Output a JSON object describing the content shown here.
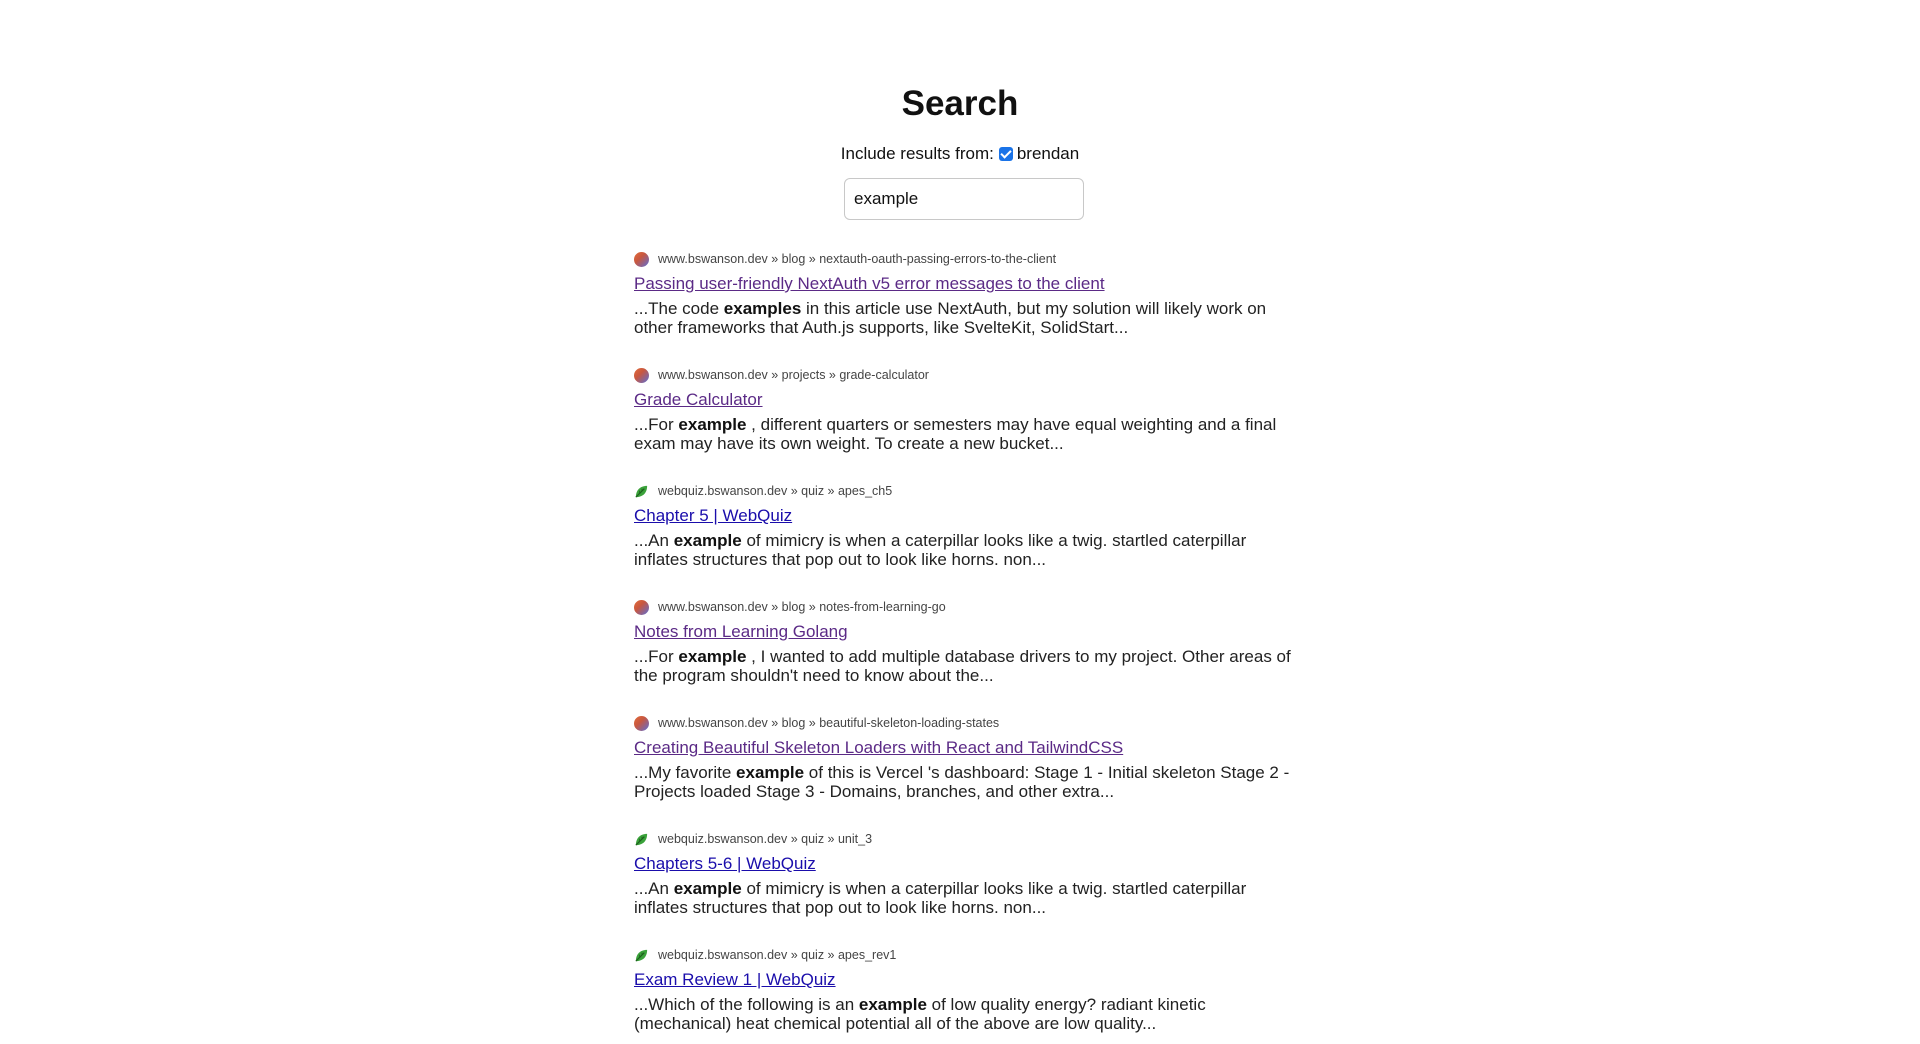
{
  "page": {
    "title": "Search"
  },
  "filter": {
    "label": "Include results from:",
    "option_label": "brendan",
    "option_checked": true
  },
  "search": {
    "value": "example",
    "placeholder": ""
  },
  "results": [
    {
      "icon": "site-orb-icon",
      "breadcrumb": "www.bswanson.dev » blog » nextauth-oauth-passing-errors-to-the-client",
      "title": "Passing user-friendly NextAuth v5 error messages to the client",
      "visited": true,
      "snippet_before": "...The code ",
      "snippet_match": "examples",
      "snippet_after": " in this article use NextAuth, but my solution will likely work on other frameworks that Auth.js supports, like SvelteKit, SolidStart..."
    },
    {
      "icon": "site-orb-icon",
      "breadcrumb": "www.bswanson.dev » projects » grade-calculator",
      "title": "Grade Calculator",
      "visited": true,
      "snippet_before": "...For ",
      "snippet_match": "example",
      "snippet_after": " , different quarters or semesters may have equal weighting and a final exam may have its own weight. To create a new bucket..."
    },
    {
      "icon": "leaf-icon",
      "breadcrumb": "webquiz.bswanson.dev » quiz » apes_ch5",
      "title": "Chapter 5 | WebQuiz",
      "visited": false,
      "snippet_before": "...An ",
      "snippet_match": "example",
      "snippet_after": " of mimicry is when a caterpillar looks like a twig. startled caterpillar inflates structures that pop out to look like horns. non..."
    },
    {
      "icon": "site-orb-icon",
      "breadcrumb": "www.bswanson.dev » blog » notes-from-learning-go",
      "title": "Notes from Learning Golang",
      "visited": true,
      "snippet_before": "...For ",
      "snippet_match": "example",
      "snippet_after": " , I wanted to add multiple database drivers to my project. Other areas of the program shouldn't need to know about the..."
    },
    {
      "icon": "site-orb-icon",
      "breadcrumb": "www.bswanson.dev » blog » beautiful-skeleton-loading-states",
      "title": "Creating Beautiful Skeleton Loaders with React and TailwindCSS",
      "visited": true,
      "snippet_before": "...My favorite ",
      "snippet_match": "example",
      "snippet_after": " of this is Vercel 's dashboard: Stage 1 - Initial skeleton Stage 2 - Projects loaded Stage 3 - Domains, branches, and other extra..."
    },
    {
      "icon": "leaf-icon",
      "breadcrumb": "webquiz.bswanson.dev » quiz » unit_3",
      "title": "Chapters 5-6 | WebQuiz",
      "visited": false,
      "snippet_before": "...An ",
      "snippet_match": "example",
      "snippet_after": " of mimicry is when a caterpillar looks like a twig. startled caterpillar inflates structures that pop out to look like horns. non..."
    },
    {
      "icon": "leaf-icon",
      "breadcrumb": "webquiz.bswanson.dev » quiz » apes_rev1",
      "title": "Exam Review 1 | WebQuiz",
      "visited": false,
      "snippet_before": "...Which of the following is an ",
      "snippet_match": "example",
      "snippet_after": " of low quality energy? radiant kinetic (mechanical) heat chemical potential all of the above are low quality..."
    }
  ]
}
